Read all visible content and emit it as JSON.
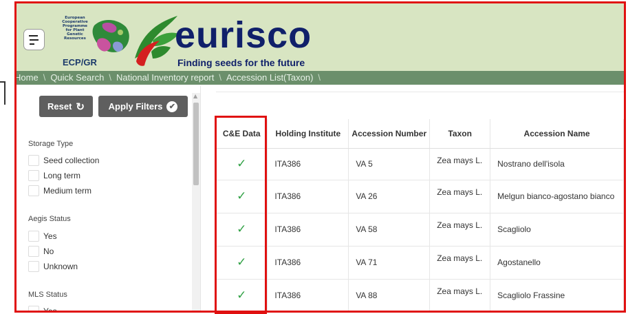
{
  "header": {
    "org_lines": [
      "European",
      "Cooperative",
      "Programme",
      "for Plant",
      "Genetic",
      "Resources"
    ],
    "org_short": "ECP/GR",
    "brand": "eurisco",
    "tagline": "Finding seeds for the future",
    "brand_color": "#10206a",
    "header_bg": "#d8e5c2",
    "leaf_color": "#2e8a2e",
    "accent_red": "#e01010"
  },
  "breadcrumb": [
    "Home",
    "Quick Search",
    "National Inventory report",
    "Accession List(Taxon)"
  ],
  "sidebar": {
    "reset_label": "Reset",
    "apply_label": "Apply Filters",
    "groups": [
      {
        "title": "Storage Type",
        "options": [
          "Seed collection",
          "Long term",
          "Medium term"
        ]
      },
      {
        "title": "Aegis Status",
        "options": [
          "Yes",
          "No",
          "Unknown"
        ]
      },
      {
        "title": "MLS Status",
        "options": [
          "Yes"
        ]
      }
    ]
  },
  "table": {
    "headers": [
      "C&E Data",
      "Holding Institute",
      "Accession Number",
      "Taxon",
      "Accession Name"
    ],
    "check_color": "#2ea043",
    "rows": [
      {
        "ce": "✓",
        "institute": "ITA386",
        "accession": "VA 5",
        "taxon": "Zea mays L.",
        "name": "Nostrano dell'isola"
      },
      {
        "ce": "✓",
        "institute": "ITA386",
        "accession": "VA 26",
        "taxon": "Zea mays L.",
        "name": "Melgun bianco-agostano bianco"
      },
      {
        "ce": "✓",
        "institute": "ITA386",
        "accession": "VA 58",
        "taxon": "Zea mays L.",
        "name": "Scagliolo"
      },
      {
        "ce": "✓",
        "institute": "ITA386",
        "accession": "VA 71",
        "taxon": "Zea mays L.",
        "name": "Agostanello"
      },
      {
        "ce": "✓",
        "institute": "ITA386",
        "accession": "VA 88",
        "taxon": "Zea mays L.",
        "name": "Scagliolo Frassine"
      }
    ]
  }
}
